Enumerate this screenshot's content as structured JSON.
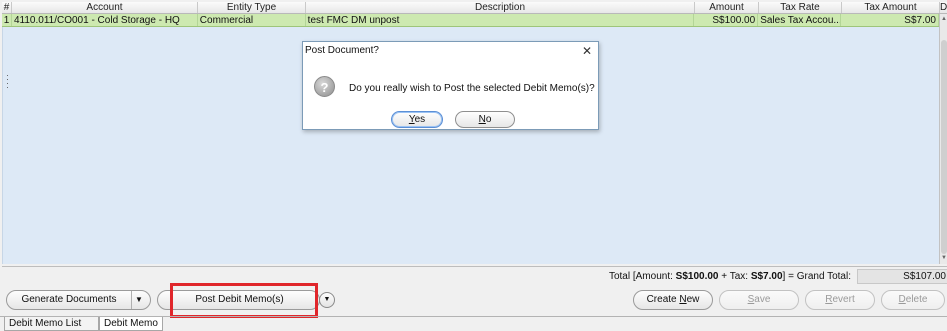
{
  "grid": {
    "columns": [
      "#",
      "Account",
      "Entity Type",
      "Description",
      "Amount",
      "Tax Rate",
      "Tax Amount",
      "D"
    ],
    "rows": [
      {
        "num": "1",
        "account": "4110.011/CO001 - Cold Storage - HQ",
        "entity_type": "Commercial",
        "description": "test FMC DM unpost",
        "amount": "S$100.00",
        "tax_rate": "Sales Tax Accou...",
        "tax_amount": "S$7.00"
      }
    ]
  },
  "totals": {
    "prefix": "Total [Amount: ",
    "amount": "S$100.00",
    "mid": " + Tax: ",
    "tax": "S$7.00",
    "suffix": "] =  Grand Total:",
    "grand_total": "S$107.00"
  },
  "toolbar": {
    "generate_documents": "Generate Documents",
    "post_debit_memo": "Post Debit Memo(s)",
    "create_new_pre": "Create ",
    "create_new_mn": "N",
    "create_new_post": "ew",
    "save_pre": "",
    "save_mn": "S",
    "save_post": "ave",
    "revert_pre": "",
    "revert_mn": "R",
    "revert_post": "evert",
    "delete_pre": "",
    "delete_mn": "D",
    "delete_post": "elete"
  },
  "tabs": [
    "Debit Memo List",
    "Debit Memo"
  ],
  "dialog": {
    "title": "Post Document?",
    "close": "✕",
    "message": "Do you really wish to Post the selected Debit Memo(s)?",
    "yes_mn": "Y",
    "yes_rest": "es",
    "no_mn": "N",
    "no_rest": "o",
    "icon": "question-icon"
  },
  "colors": {
    "selected_row": "#cde9b0",
    "grid_background": "#dde9f6",
    "highlight_box": "#e0262b"
  }
}
